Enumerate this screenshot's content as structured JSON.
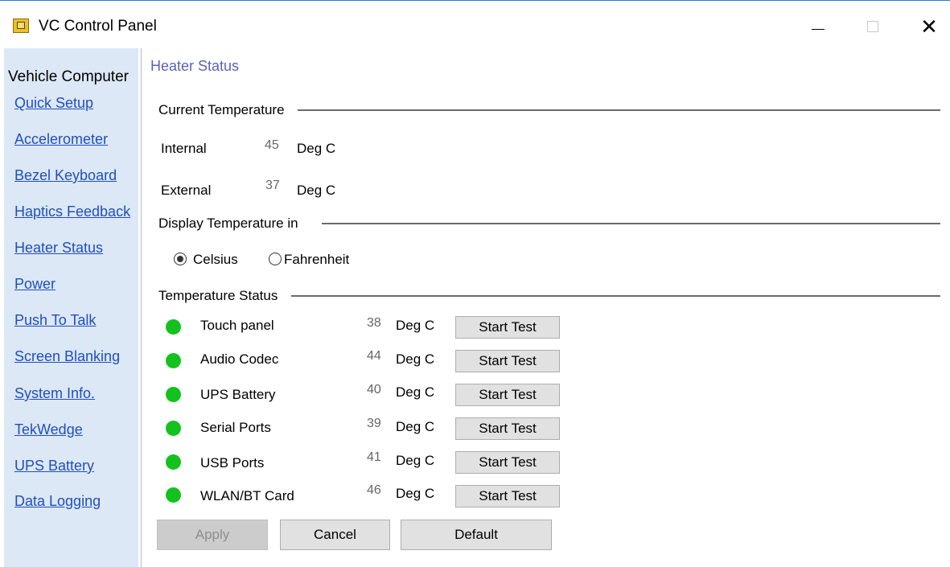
{
  "window": {
    "title": "VC Control Panel",
    "close_glyph": "✕"
  },
  "sidebar": {
    "heading": "Vehicle Computer",
    "items": [
      {
        "label": "Quick Setup"
      },
      {
        "label": "Accelerometer"
      },
      {
        "label": "Bezel Keyboard"
      },
      {
        "label": "Haptics Feedback"
      },
      {
        "label": "Heater Status"
      },
      {
        "label": "Power"
      },
      {
        "label": "Push To Talk"
      },
      {
        "label": "Screen Blanking"
      },
      {
        "label": "System Info."
      },
      {
        "label": "TekWedge"
      },
      {
        "label": "UPS Battery"
      },
      {
        "label": "Data Logging"
      }
    ]
  },
  "main": {
    "title": "Heater Status",
    "current_temp": {
      "heading": "Current Temperature",
      "internal": {
        "label": "Internal",
        "value": "45",
        "unit": "Deg C"
      },
      "external": {
        "label": "External",
        "value": "37",
        "unit": "Deg C"
      }
    },
    "display": {
      "heading": "Display Temperature in",
      "celsius": "Celsius",
      "fahrenheit": "Fahrenheit",
      "selected": "Celsius"
    },
    "status": {
      "heading": "Temperature Status",
      "status_color": "#13c21f",
      "rows": [
        {
          "name": "Touch panel",
          "value": "38",
          "unit": "Deg C",
          "button": "Start Test"
        },
        {
          "name": "Audio Codec",
          "value": "44",
          "unit": "Deg C",
          "button": "Start Test"
        },
        {
          "name": "UPS Battery",
          "value": "40",
          "unit": "Deg C",
          "button": "Start Test"
        },
        {
          "name": "Serial Ports",
          "value": "39",
          "unit": "Deg C",
          "button": "Start Test"
        },
        {
          "name": "USB Ports",
          "value": "41",
          "unit": "Deg C",
          "button": "Start Test"
        },
        {
          "name": "WLAN/BT Card",
          "value": "46",
          "unit": "Deg C",
          "button": "Start Test"
        }
      ]
    },
    "footer": {
      "apply": "Apply",
      "cancel": "Cancel",
      "default": "Default"
    }
  }
}
